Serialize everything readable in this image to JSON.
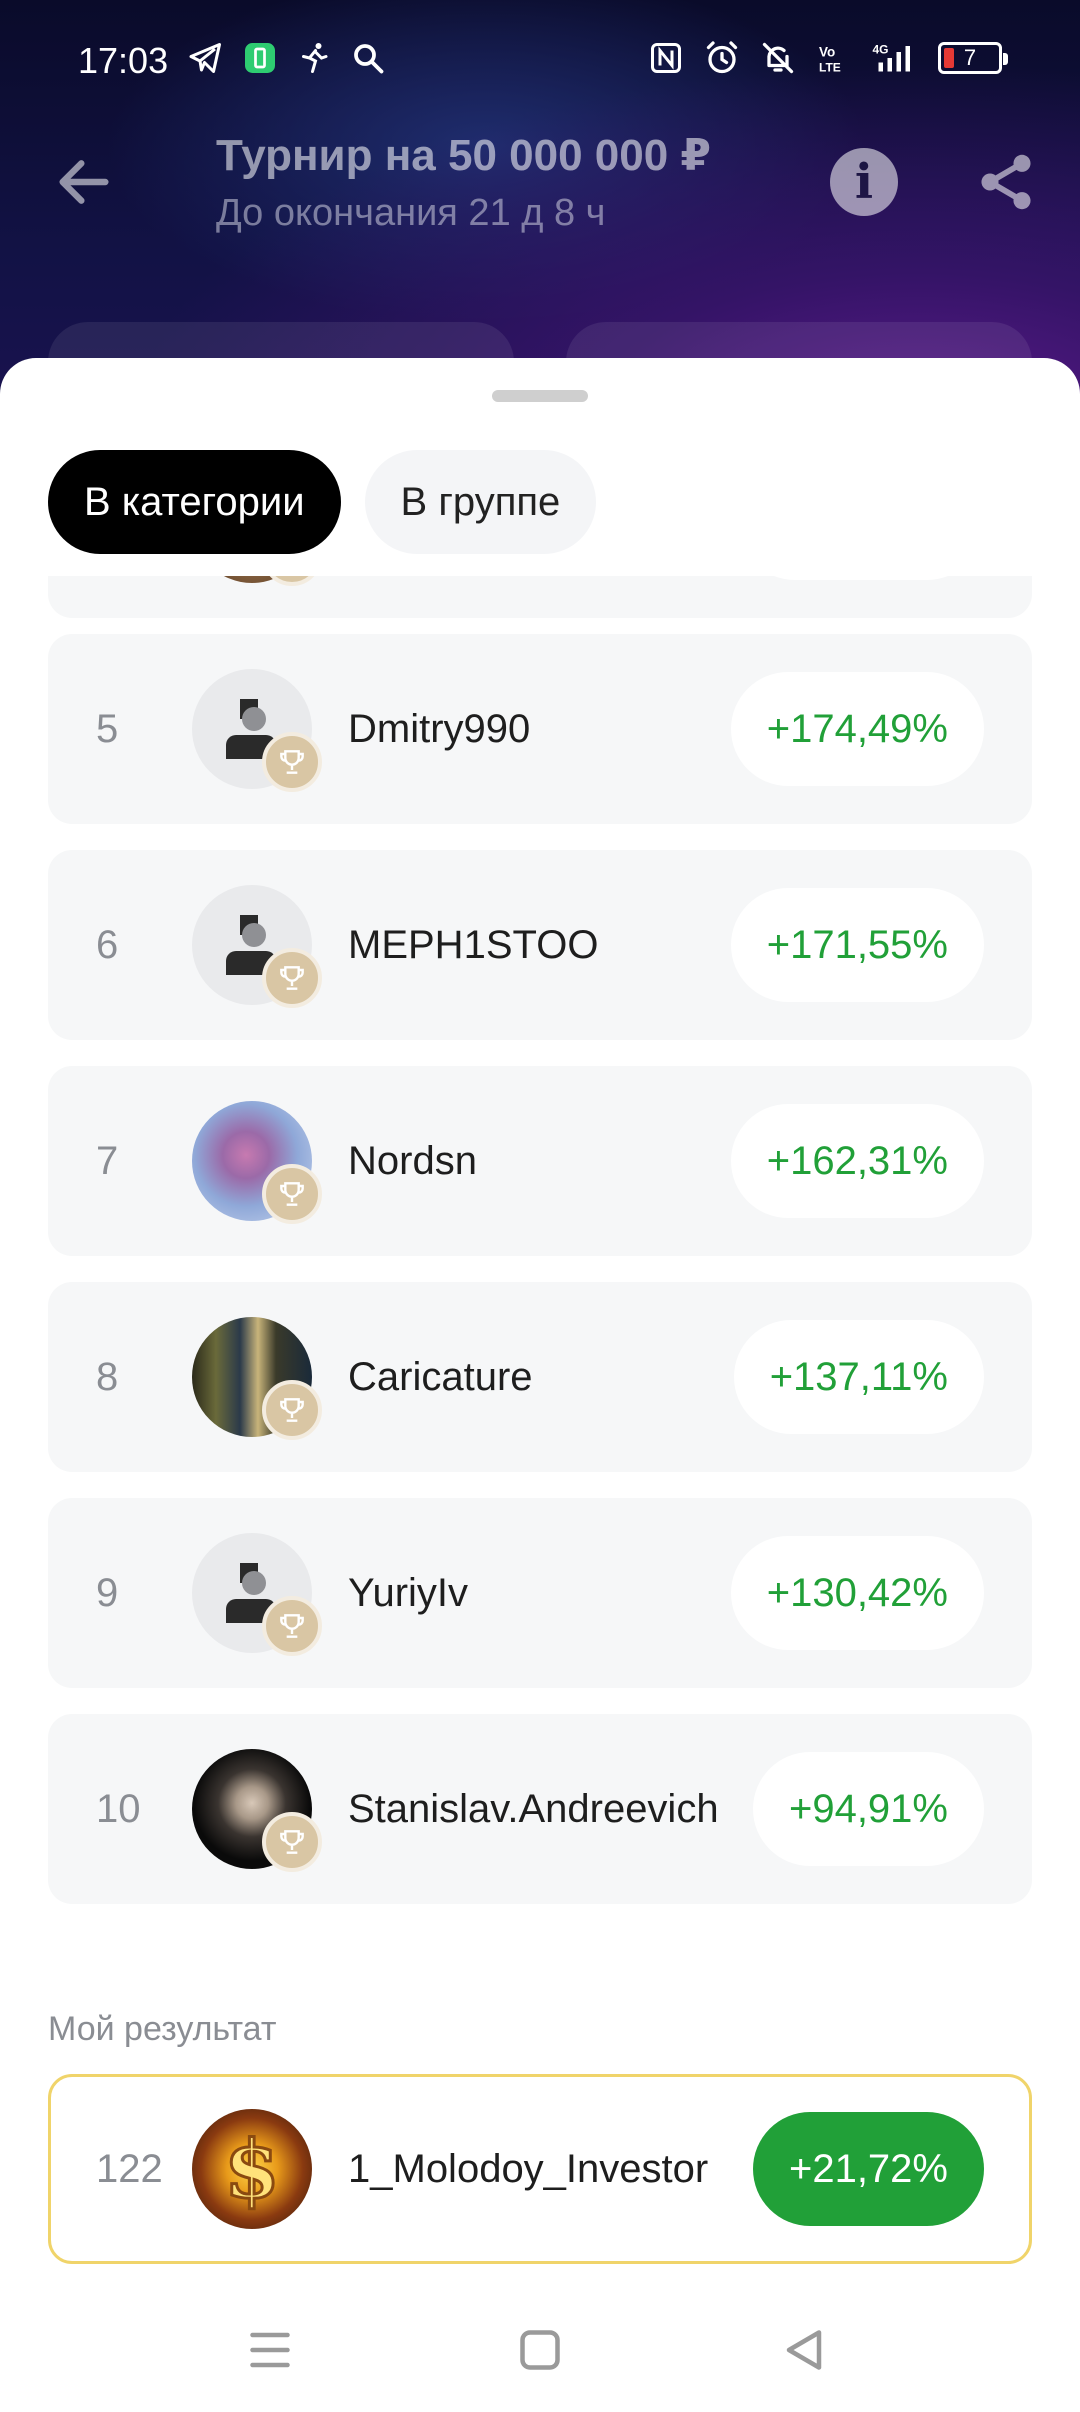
{
  "status_bar": {
    "time": "17:03",
    "battery": "7",
    "left_icons": [
      "telegram-icon",
      "battery-saver-icon",
      "activity-icon",
      "search-icon"
    ],
    "right_icons": [
      "nfc-icon",
      "alarm-icon",
      "mute-icon",
      "volte-icon",
      "signal-4g-icon",
      "battery-icon"
    ]
  },
  "header": {
    "title": "Турнир на 50 000 000 ₽",
    "subtitle": "До окончания 21 д 8 ч"
  },
  "tabs": [
    {
      "label": "В категории",
      "active": true
    },
    {
      "label": "В группе",
      "active": false
    }
  ],
  "leaderboard": [
    {
      "rank": "5",
      "name": "Dmitry990",
      "result": "+174,49%",
      "avatar": "default"
    },
    {
      "rank": "6",
      "name": "MEPH1STOO",
      "result": "+171,55%",
      "avatar": "default"
    },
    {
      "rank": "7",
      "name": "Nordsn",
      "result": "+162,31%",
      "avatar": "photo"
    },
    {
      "rank": "8",
      "name": "Caricature",
      "result": "+137,11%",
      "avatar": "photo"
    },
    {
      "rank": "9",
      "name": "YuriyIv",
      "result": "+130,42%",
      "avatar": "default"
    },
    {
      "rank": "10",
      "name": "Stanislav.Andreevich",
      "result": "+94,91%",
      "avatar": "photo"
    }
  ],
  "my_result": {
    "label": "Мой результат",
    "rank": "122",
    "name": "1_Molodoy_Investor",
    "result": "+21,72%"
  },
  "colors": {
    "accent_green": "#21a038",
    "highlight_border": "#f0d46a"
  }
}
